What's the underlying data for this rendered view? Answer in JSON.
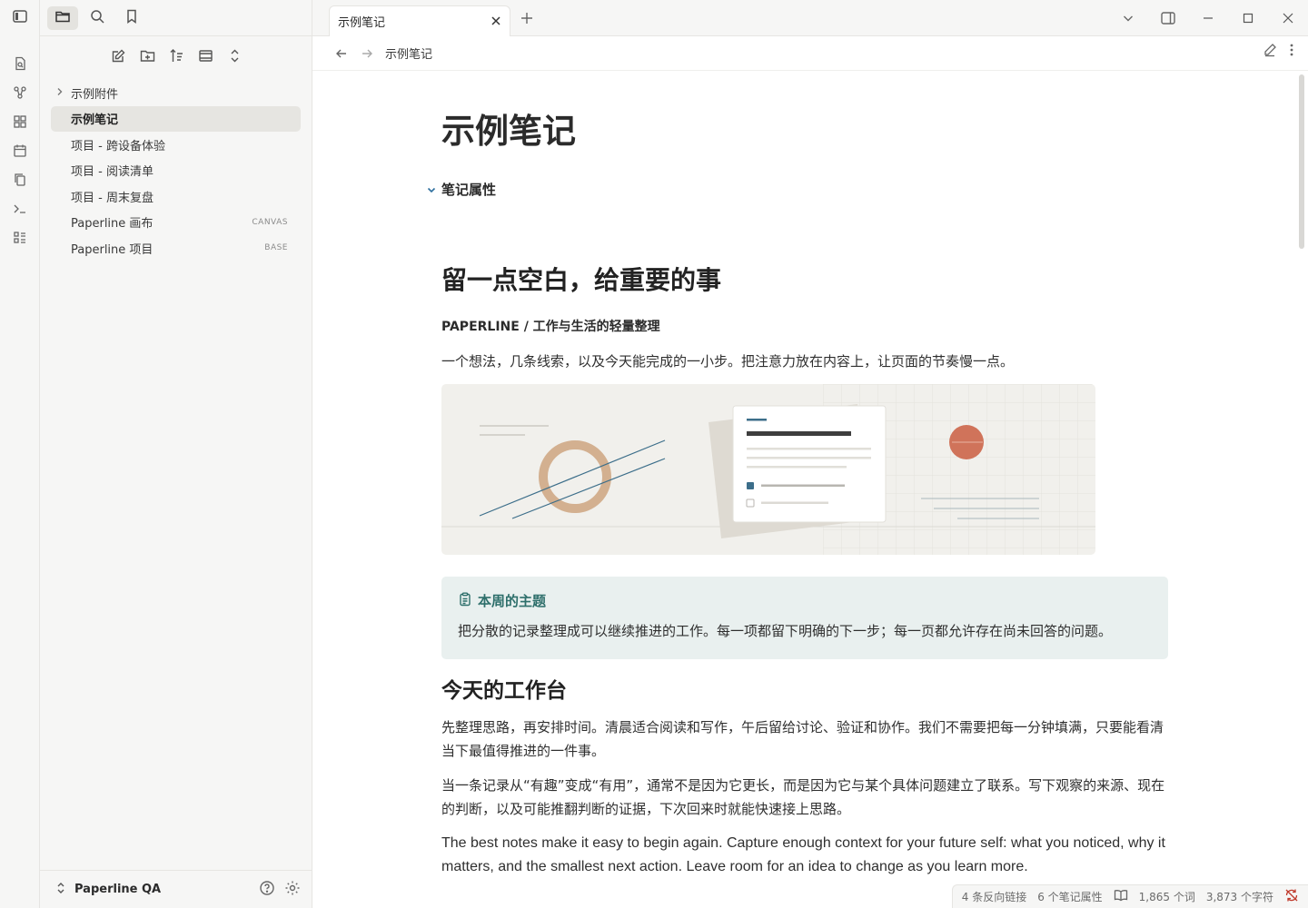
{
  "sidebar": {
    "tree": [
      {
        "label": "示例附件",
        "type": "folder"
      },
      {
        "label": "示例笔记",
        "active": true
      },
      {
        "label": "项目 - 跨设备体验"
      },
      {
        "label": "项目 - 阅读清单"
      },
      {
        "label": "项目 - 周末复盘"
      },
      {
        "label": "Paperline 画布",
        "badge": "CANVAS"
      },
      {
        "label": "Paperline 项目",
        "badge": "BASE"
      }
    ],
    "vault_name": "Paperline QA"
  },
  "tab": {
    "label": "示例笔记"
  },
  "breadcrumb": "示例笔记",
  "note": {
    "title": "示例笔记",
    "properties_label": "笔记属性",
    "h2": "留一点空白，给重要的事",
    "kicker": "PAPERLINE / 工作与生活的轻量整理",
    "lead": "一个想法，几条线索，以及今天能完成的一小步。把注意力放在内容上，让页面的节奏慢一点。",
    "callout_title": "本周的主题",
    "callout_body": "把分散的记录整理成可以继续推进的工作。每一项都留下明确的下一步；每一页都允许存在尚未回答的问题。",
    "h3": "今天的工作台",
    "p1": "先整理思路，再安排时间。清晨适合阅读和写作，午后留给讨论、验证和协作。我们不需要把每一分钟填满，只要能看清当下最值得推进的一件事。",
    "p2": "当一条记录从“有趣”变成“有用”，通常不是因为它更长，而是因为它与某个具体问题建立了联系。写下观察的来源、现在的判断，以及可能推翻判断的证据，下次回来时就能快速接上思路。",
    "p3": "The best notes make it easy to begin again. Capture enough context for your future self: what you noticed, why it matters, and the smallest next action. Leave room for an idea to change as you learn more."
  },
  "status": {
    "backlinks": "4 条反向链接",
    "properties": "6 个笔记属性",
    "words": "1,865 个词",
    "chars": "3,873 个字符"
  },
  "colors": {
    "accent_teal": "#2e6f6b",
    "callout_bg": "#e9f0ef",
    "hero_bg": "#f1f0ec",
    "sun": "#d0735a"
  }
}
